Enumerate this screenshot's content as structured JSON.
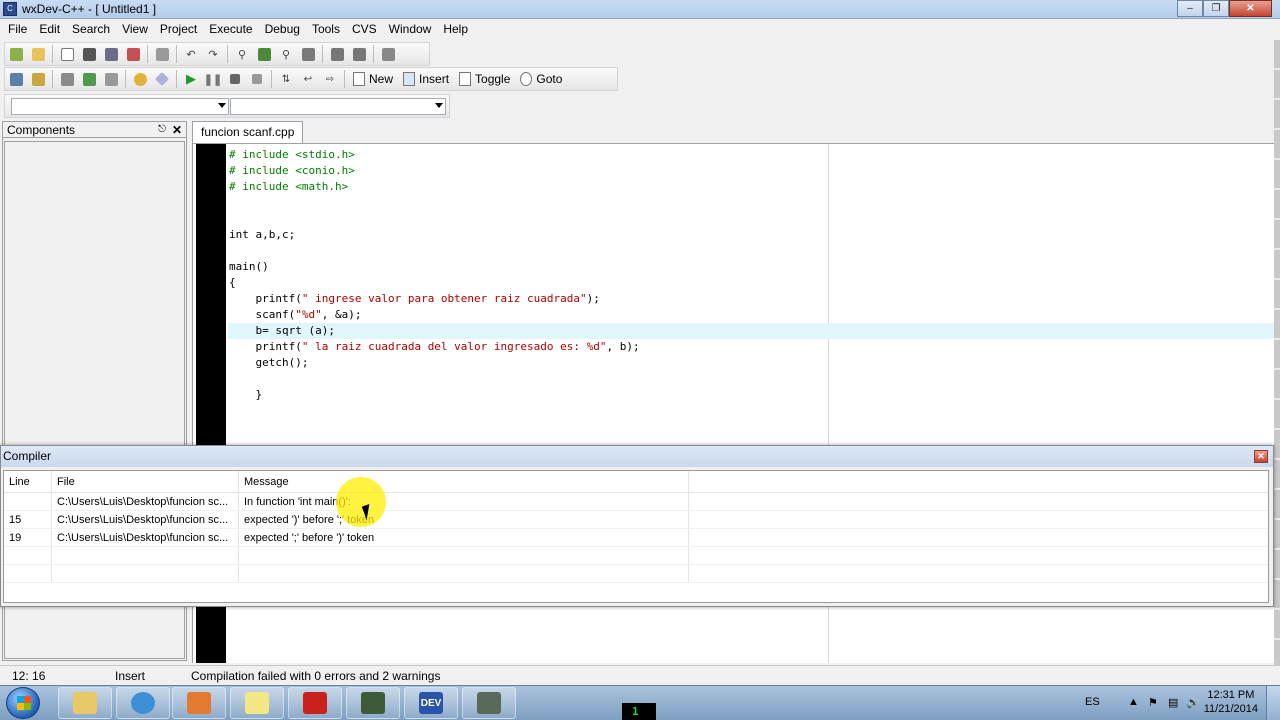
{
  "window": {
    "title": "wxDev-C++ - [ Untitled1 ]"
  },
  "menu": [
    "File",
    "Edit",
    "Search",
    "View",
    "Project",
    "Execute",
    "Debug",
    "Tools",
    "CVS",
    "Window",
    "Help"
  ],
  "toolbar": {
    "new_label": "New",
    "insert_label": "Insert",
    "toggle_label": "Toggle",
    "goto_label": "Goto"
  },
  "components": {
    "title": "Components"
  },
  "editor": {
    "tab": "funcion scanf.cpp",
    "lines": [
      "# include <stdio.h>",
      "# include <conio.h>",
      "# include <math.h>",
      "",
      "",
      "int a,b,c;",
      "",
      "main()",
      "{",
      "    printf(\" ingrese valor para obtener raiz cuadrada\");",
      "    scanf(\"%d\", &a);",
      "    b= sqrt (a);",
      "    printf(\" la raiz cuadrada del valor ingresado es: %d\", b);",
      "    getch();",
      "",
      "    }"
    ]
  },
  "compiler": {
    "title": "Compiler",
    "columns": [
      "Line",
      "File",
      "Message"
    ],
    "rows": [
      {
        "line": "",
        "file": "C:\\Users\\Luis\\Desktop\\funcion sc...",
        "message": "In function 'int main()':"
      },
      {
        "line": "15",
        "file": "C:\\Users\\Luis\\Desktop\\funcion sc...",
        "message": "expected ')' before ';' token"
      },
      {
        "line": "19",
        "file": "C:\\Users\\Luis\\Desktop\\funcion sc...",
        "message": "expected ';' before ')' token"
      }
    ]
  },
  "status": {
    "position": "12: 16",
    "mode": "Insert",
    "message": "Compilation failed with 0 errors and 2 warnings"
  },
  "taskbar": {
    "lang": "ES",
    "time": "12:31 PM",
    "date": "11/21/2014",
    "dev_label": "DEV",
    "term_label": "1"
  }
}
